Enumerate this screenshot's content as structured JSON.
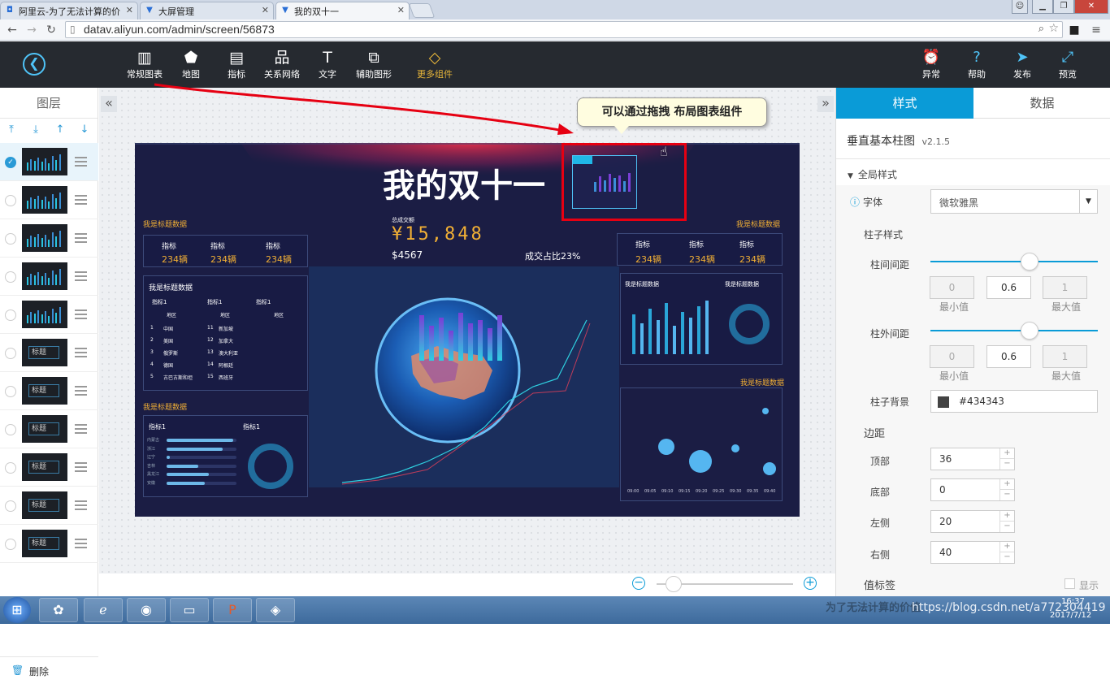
{
  "browser": {
    "tabs": [
      {
        "icon": "aliyun-icon",
        "title": "阿里云-为了无法计算的价"
      },
      {
        "icon": "datav-icon",
        "title": "大屏管理"
      },
      {
        "icon": "datav-icon",
        "title": "我的双十一"
      }
    ],
    "url": "datav.aliyun.com/admin/screen/56873"
  },
  "toolbar": {
    "tools": [
      "常规图表",
      "地图",
      "指标",
      "关系网络",
      "文字",
      "辅助图形",
      "更多组件"
    ],
    "right_tools": [
      "异常",
      "帮助",
      "发布",
      "预览"
    ]
  },
  "layers": {
    "title": "图层",
    "thumb_label": "标题",
    "delete_label": "删除",
    "rows": [
      {
        "type": "bars",
        "selected": true
      },
      {
        "type": "bars",
        "selected": false
      },
      {
        "type": "bars",
        "selected": false
      },
      {
        "type": "bars",
        "selected": false
      },
      {
        "type": "bars",
        "selected": false
      },
      {
        "type": "title",
        "selected": false
      },
      {
        "type": "title",
        "selected": false
      },
      {
        "type": "title",
        "selected": false
      },
      {
        "type": "title",
        "selected": false
      },
      {
        "type": "title",
        "selected": false
      },
      {
        "type": "title",
        "selected": false
      }
    ]
  },
  "tooltip": "可以通过拖拽 布局图表组件",
  "screen": {
    "title": "我的双十一",
    "section_title": "我是标题数据",
    "total_label": "总成交额",
    "total_value": "¥15,848",
    "sub_value": "$4567",
    "ratio": "成交占比23%",
    "metric_label": "指标",
    "metric_value": "234辆",
    "indicator": "指标1",
    "region": "地区",
    "table_rows": [
      [
        "1",
        "中国",
        "11",
        "新加坡"
      ],
      [
        "2",
        "美国",
        "12",
        "加拿大"
      ],
      [
        "3",
        "俄罗斯",
        "13",
        "澳大利亚"
      ],
      [
        "4",
        "德国",
        "14",
        "阿根廷"
      ],
      [
        "5",
        "古巴古斯和坦",
        "15",
        "西班牙"
      ]
    ],
    "bar_labels": [
      "内蒙古",
      "浙江",
      "辽宁",
      "吉林",
      "黑龙江",
      "安徽"
    ],
    "time_labels": [
      "09:00",
      "09:05",
      "09:10",
      "09:15",
      "09:20",
      "09:25",
      "09:30",
      "09:35",
      "09:40"
    ]
  },
  "props": {
    "tabs": [
      "样式",
      "数据"
    ],
    "component_name": "垂直基本柱图",
    "version": "v2.1.5",
    "global_style": "全局样式",
    "font_label": "字体",
    "font_value": "微软雅黑",
    "bar_style": "柱子样式",
    "inner_gap": "柱间间距",
    "outer_gap": "柱外间距",
    "min_label": "最小值",
    "max_label": "最大值",
    "gap_min": "0",
    "gap_value": "0.6",
    "gap_max": "1",
    "bar_bg_label": "柱子背景",
    "bar_bg_value": "#434343",
    "margin_label": "边距",
    "top_label": "顶部",
    "top_value": "36",
    "bottom_label": "底部",
    "bottom_value": "0",
    "left_label": "左侧",
    "left_value": "20",
    "right_label": "右侧",
    "right_value": "40",
    "value_label": "值标签",
    "show_label": "显示"
  },
  "taskbar": {
    "clock_time": "16:37",
    "clock_date": "2017/7/12",
    "watermark": "https://blog.csdn.net/a772304419",
    "overlay_text": "为了无法计算的价值"
  },
  "colors": {
    "accent": "#0a9bd7",
    "highlight": "#e60012",
    "screen_bg": "#1b1d44",
    "gold": "#f2b035"
  }
}
